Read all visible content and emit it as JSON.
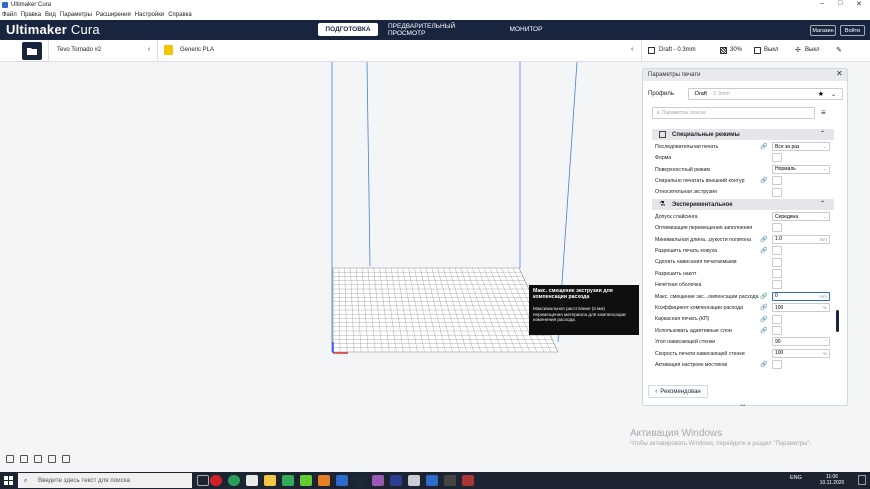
{
  "window": {
    "title": "Ultimaker Cura"
  },
  "menu": [
    "Файл",
    "Правка",
    "Вид",
    "Параметры",
    "Расширения",
    "Настройки",
    "Справка"
  ],
  "header": {
    "logo_main": "Ultimaker",
    "logo_sub": "Cura",
    "stages": [
      "ПОДГОТОВКА",
      "ПРЕДВАРИТЕЛЬНЫЙ ПРОСМОТР",
      "МОНИТОР"
    ],
    "marketplace": "Магазин",
    "signin": "Войти"
  },
  "topbar": {
    "printer": "Tevo Tornado #2",
    "material": "Generic PLA",
    "profile": "Draft - 0.3mm",
    "infill": "30%",
    "support": "Выкл",
    "adhesion": "Выкл"
  },
  "panel": {
    "title": "Параметры печати",
    "profile_label": "Профиль",
    "profile_value": "Draft",
    "profile_detail": "- 0.3mm",
    "search_placeholder": "Параметры поиска",
    "cat_special": "Специальные режимы",
    "cat_experimental": "Экспериментальное",
    "special_rows": [
      {
        "label": "Последовательная печать",
        "value": "Все за раз",
        "type": "select"
      },
      {
        "label": "Форма",
        "value": "",
        "type": "check"
      },
      {
        "label": "Поверхностный режим",
        "value": "Нормаль",
        "type": "select"
      },
      {
        "label": "Спирально печатать внешний контур",
        "value": "",
        "type": "check"
      },
      {
        "label": "Относительная экструзия",
        "value": "",
        "type": "check"
      }
    ],
    "exp_rows": [
      {
        "label": "Допуск слайсинга",
        "value": "Середина",
        "type": "select"
      },
      {
        "label": "Оптимизация перемещения заполнения",
        "value": "",
        "type": "check"
      },
      {
        "label": "Минимальная длина...рукости полигона",
        "value": "1.0",
        "unit": "mm",
        "type": "input"
      },
      {
        "label": "Разрешить печать кожуха",
        "value": "",
        "type": "check"
      },
      {
        "label": "Сделать нависания печатаемыми",
        "value": "",
        "type": "check"
      },
      {
        "label": "Разрешить наклт",
        "value": "",
        "type": "check"
      },
      {
        "label": "Нечёткая оболочка",
        "value": "",
        "type": "check"
      },
      {
        "label": "Макс. смещение экс...омпенсации расхода",
        "value": "0",
        "unit": "mm",
        "type": "input"
      },
      {
        "label": "Коэффициент компенсации расхода",
        "value": "100",
        "unit": "%",
        "type": "input"
      },
      {
        "label": "Каркасная печать (КП)",
        "value": "",
        "type": "check"
      },
      {
        "label": "Использовать адаптивные слои",
        "value": "",
        "type": "check"
      },
      {
        "label": "Угол нависающей стенки",
        "value": "90",
        "unit": "°",
        "type": "input"
      },
      {
        "label": "Скорость печати нависающей стенки",
        "value": "100",
        "unit": "%",
        "type": "input"
      },
      {
        "label": "Активация настроек мостиков",
        "value": "",
        "type": "check"
      }
    ],
    "recommended": "Рекомендован"
  },
  "tooltip": {
    "title": "Макс. смещение экструзии для компенсации расхода",
    "desc": "Максимальное расстояние (в мм) перемещения материала для компенсации изменения расхода."
  },
  "activation": {
    "title": "Активация Windows",
    "desc": "Чтобы активировать Windows, перейдите в раздел \"Параметры\"."
  },
  "taskbar": {
    "search": "Введите здесь текст для поиска",
    "time": "11:06",
    "date": "10.11.2020",
    "lang": "ENG"
  },
  "colors": {
    "header": "#19253f",
    "accent": "#2d6ac9",
    "grid_line": "#7f7f7f"
  }
}
